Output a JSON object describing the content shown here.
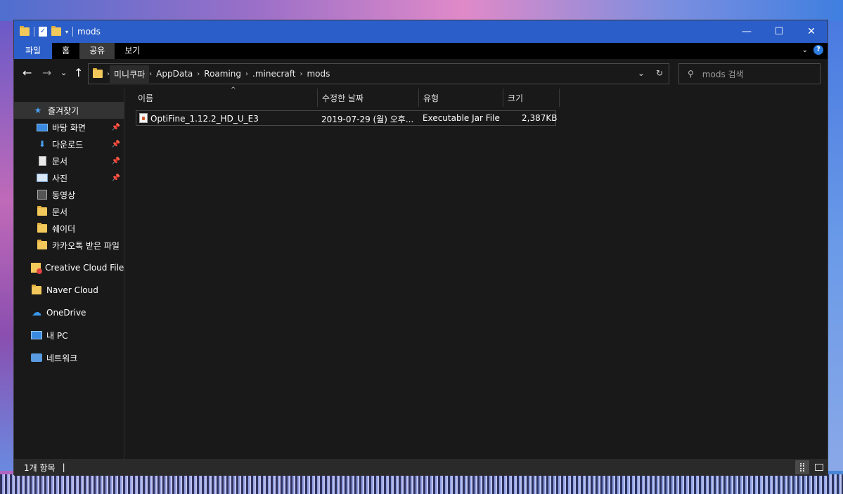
{
  "window": {
    "title": "mods",
    "quick_access_icons": [
      "folder-icon",
      "properties-icon",
      "new-folder-icon",
      "customize-dropdown-icon"
    ],
    "controls": {
      "minimize": "—",
      "maximize": "☐",
      "close": "✕"
    }
  },
  "ribbon": {
    "tabs": [
      {
        "label": "파일"
      },
      {
        "label": "홈"
      },
      {
        "label": "공유"
      },
      {
        "label": "보기"
      }
    ],
    "active_tab": "공유",
    "help": "?",
    "expand": "⌄"
  },
  "nav": {
    "back": "←",
    "forward": "→",
    "recent": "⌄",
    "up": "↑",
    "breadcrumb": [
      "미니쿠파",
      "AppData",
      "Roaming",
      ".minecraft",
      "mods"
    ],
    "dropdown": "⌄",
    "refresh": "↻",
    "search_placeholder": "mods 검색"
  },
  "sidebar": {
    "quick_access": "즐겨찾기",
    "items": [
      {
        "label": "바탕 화면",
        "icon": "desktop-icon",
        "pinned": true
      },
      {
        "label": "다운로드",
        "icon": "download-icon",
        "pinned": true
      },
      {
        "label": "문서",
        "icon": "documents-icon",
        "pinned": true
      },
      {
        "label": "사진",
        "icon": "pictures-icon",
        "pinned": true
      },
      {
        "label": "동영상",
        "icon": "videos-icon",
        "pinned": false
      },
      {
        "label": "문서",
        "icon": "folder-icon",
        "pinned": false
      },
      {
        "label": "쉐이더",
        "icon": "folder-icon",
        "pinned": false
      },
      {
        "label": "카카오톡 받은 파일",
        "icon": "folder-icon",
        "pinned": false
      }
    ],
    "roots": [
      {
        "label": "Creative Cloud Files",
        "icon": "creative-cloud-folder-icon"
      },
      {
        "label": "Naver Cloud",
        "icon": "folder-icon"
      },
      {
        "label": "OneDrive",
        "icon": "onedrive-cloud-icon"
      },
      {
        "label": "내 PC",
        "icon": "pc-icon"
      },
      {
        "label": "네트워크",
        "icon": "network-icon"
      }
    ],
    "pin_glyph": "📌"
  },
  "columns": {
    "name": "이름",
    "modified": "수정한 날짜",
    "type": "유형",
    "size": "크기",
    "sort_indicator": "^"
  },
  "files": [
    {
      "name": "OptiFine_1.12.2_HD_U_E3",
      "modified": "2019-07-29 (월) 오후...",
      "type": "Executable Jar File",
      "size": "2,387KB"
    }
  ],
  "status": {
    "item_count": "1개 항목",
    "cursor": "|"
  },
  "colors": {
    "titlebar": "#2b5ec8",
    "background": "#191919",
    "accent": "#4aa0f0"
  }
}
